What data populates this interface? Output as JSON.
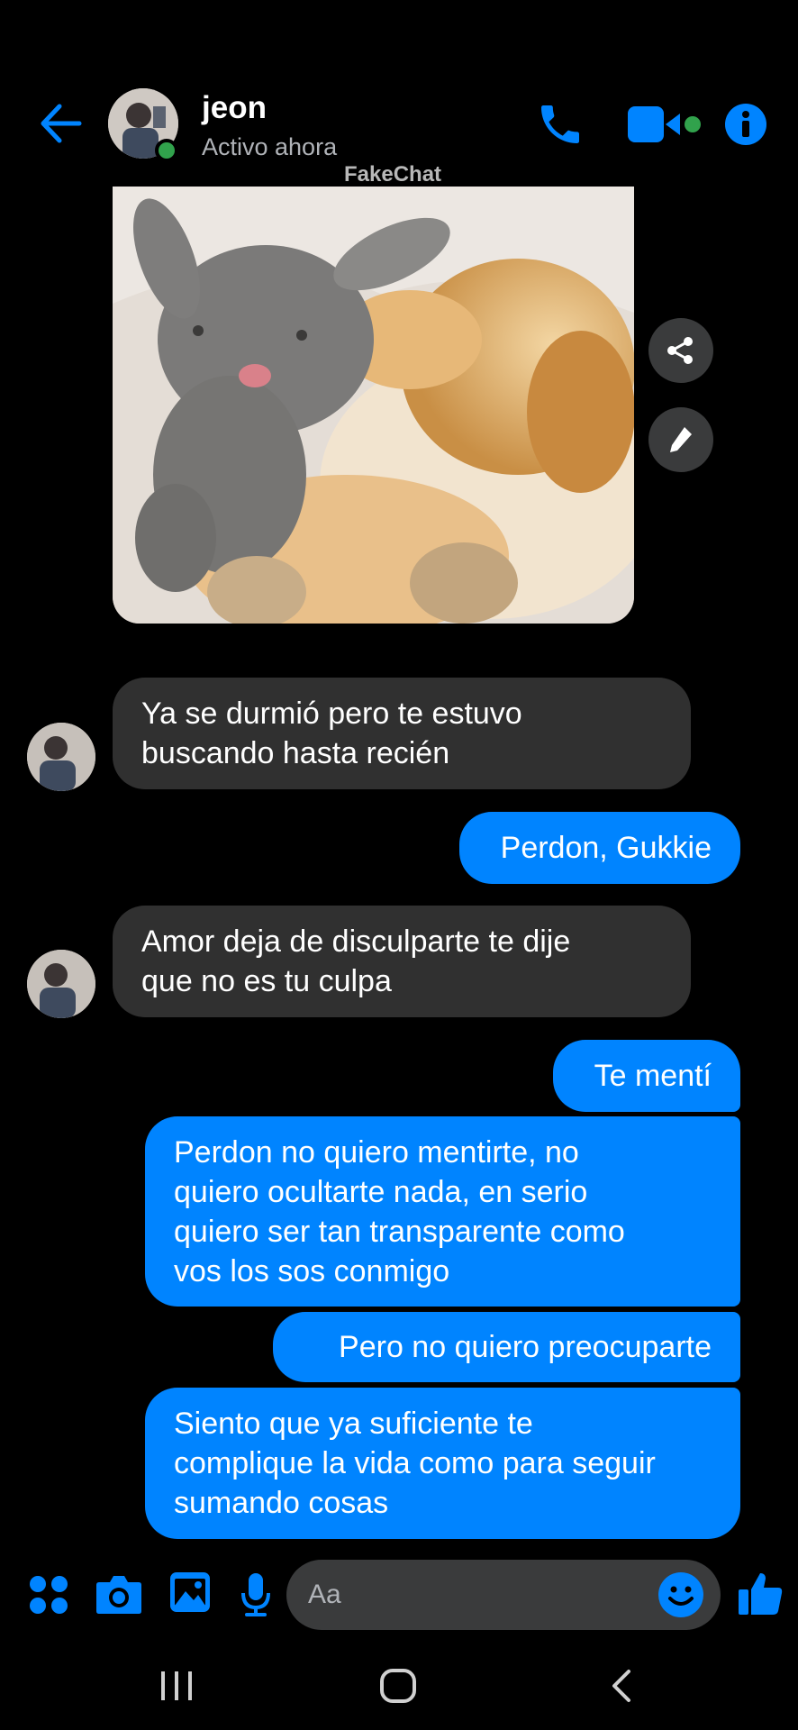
{
  "header": {
    "contact_name": "jeon",
    "status": "Activo ahora",
    "watermark": "FakeChat"
  },
  "messages": [
    {
      "id": "m1",
      "direction": "incoming",
      "text": "Ya se durmió pero te estuvo\nbuscando hasta recién"
    },
    {
      "id": "m2",
      "direction": "outgoing",
      "text": "Perdon, Gukkie"
    },
    {
      "id": "m3",
      "direction": "incoming",
      "text": "Amor deja de disculparte te dije\nque no es tu culpa"
    },
    {
      "id": "m4",
      "direction": "outgoing",
      "text": "Te mentí"
    },
    {
      "id": "m5",
      "direction": "outgoing",
      "text": "Perdon no quiero mentirte, no\nquiero ocultarte nada, en serio\nquiero ser tan transparente como\nvos los sos conmigo"
    },
    {
      "id": "m6",
      "direction": "outgoing",
      "text": "Pero no quiero preocuparte"
    },
    {
      "id": "m7",
      "direction": "outgoing",
      "text": "Siento que ya suficiente te\ncomplique la vida como para seguir\nsumando cosas"
    }
  ],
  "composer": {
    "placeholder": "Aa"
  },
  "icons": {
    "back": "arrow-left-icon",
    "call": "phone-icon",
    "video": "video-camera-icon",
    "info": "info-icon",
    "share": "share-icon",
    "edit": "pencil-icon",
    "apps": "four-dots-icon",
    "camera": "camera-icon",
    "gallery": "image-icon",
    "mic": "microphone-icon",
    "emoji": "smiley-icon",
    "like": "thumbs-up-icon"
  },
  "colors": {
    "accent": "#0084ff",
    "incoming_bubble": "#303030",
    "background": "#000000",
    "online": "#31a24c"
  }
}
